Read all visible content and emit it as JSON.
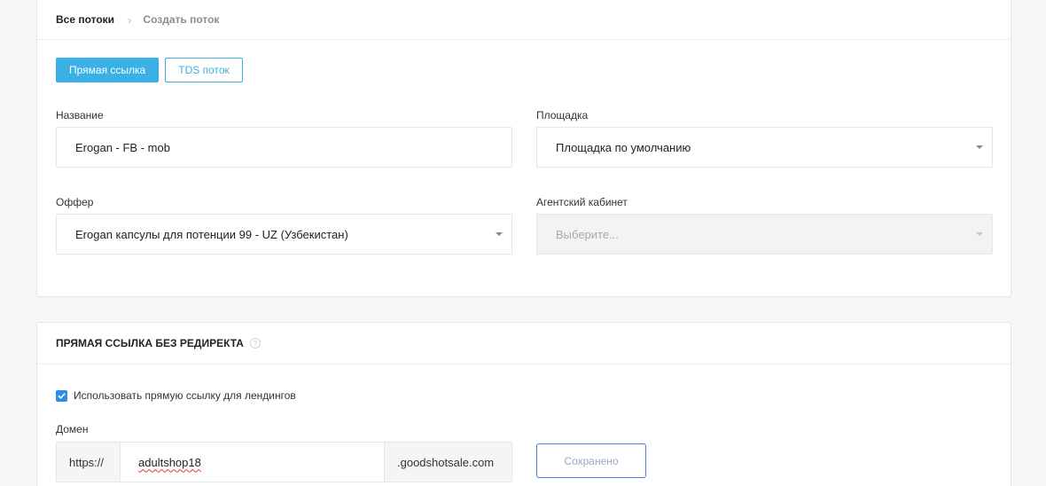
{
  "breadcrumb": {
    "root": "Все потоки",
    "separator": ">",
    "current": "Создать поток"
  },
  "tabs": [
    {
      "label": "Прямая ссылка",
      "active": true
    },
    {
      "label": "TDS поток",
      "active": false
    }
  ],
  "form": {
    "name": {
      "label": "Название",
      "value": "Erogan - FB - mob"
    },
    "platform": {
      "label": "Площадка",
      "value": "Площадка по умолчанию"
    },
    "offer": {
      "label": "Оффер",
      "value": "Erogan капсулы для потенции 99 - UZ (Узбекистан)"
    },
    "agent_cabinet": {
      "label": "Агентский кабинет",
      "placeholder": "Выберите..."
    }
  },
  "direct_link": {
    "title": "ПРЯМАЯ ССЫЛКА БЕЗ РЕДИРЕКТА",
    "help_icon": "question-circle-icon",
    "checkbox_label": "Использовать прямую ссылку для лендингов",
    "checkbox_checked": true,
    "domain": {
      "label": "Домен",
      "prefix": "https://",
      "value": "adultshop18",
      "suffix": ".goodshotsale.com"
    },
    "save_label": "Сохранено"
  },
  "colors": {
    "accent": "#3ab0e6",
    "checkbox": "#2f8de4",
    "saved_border": "#4e7de8"
  }
}
